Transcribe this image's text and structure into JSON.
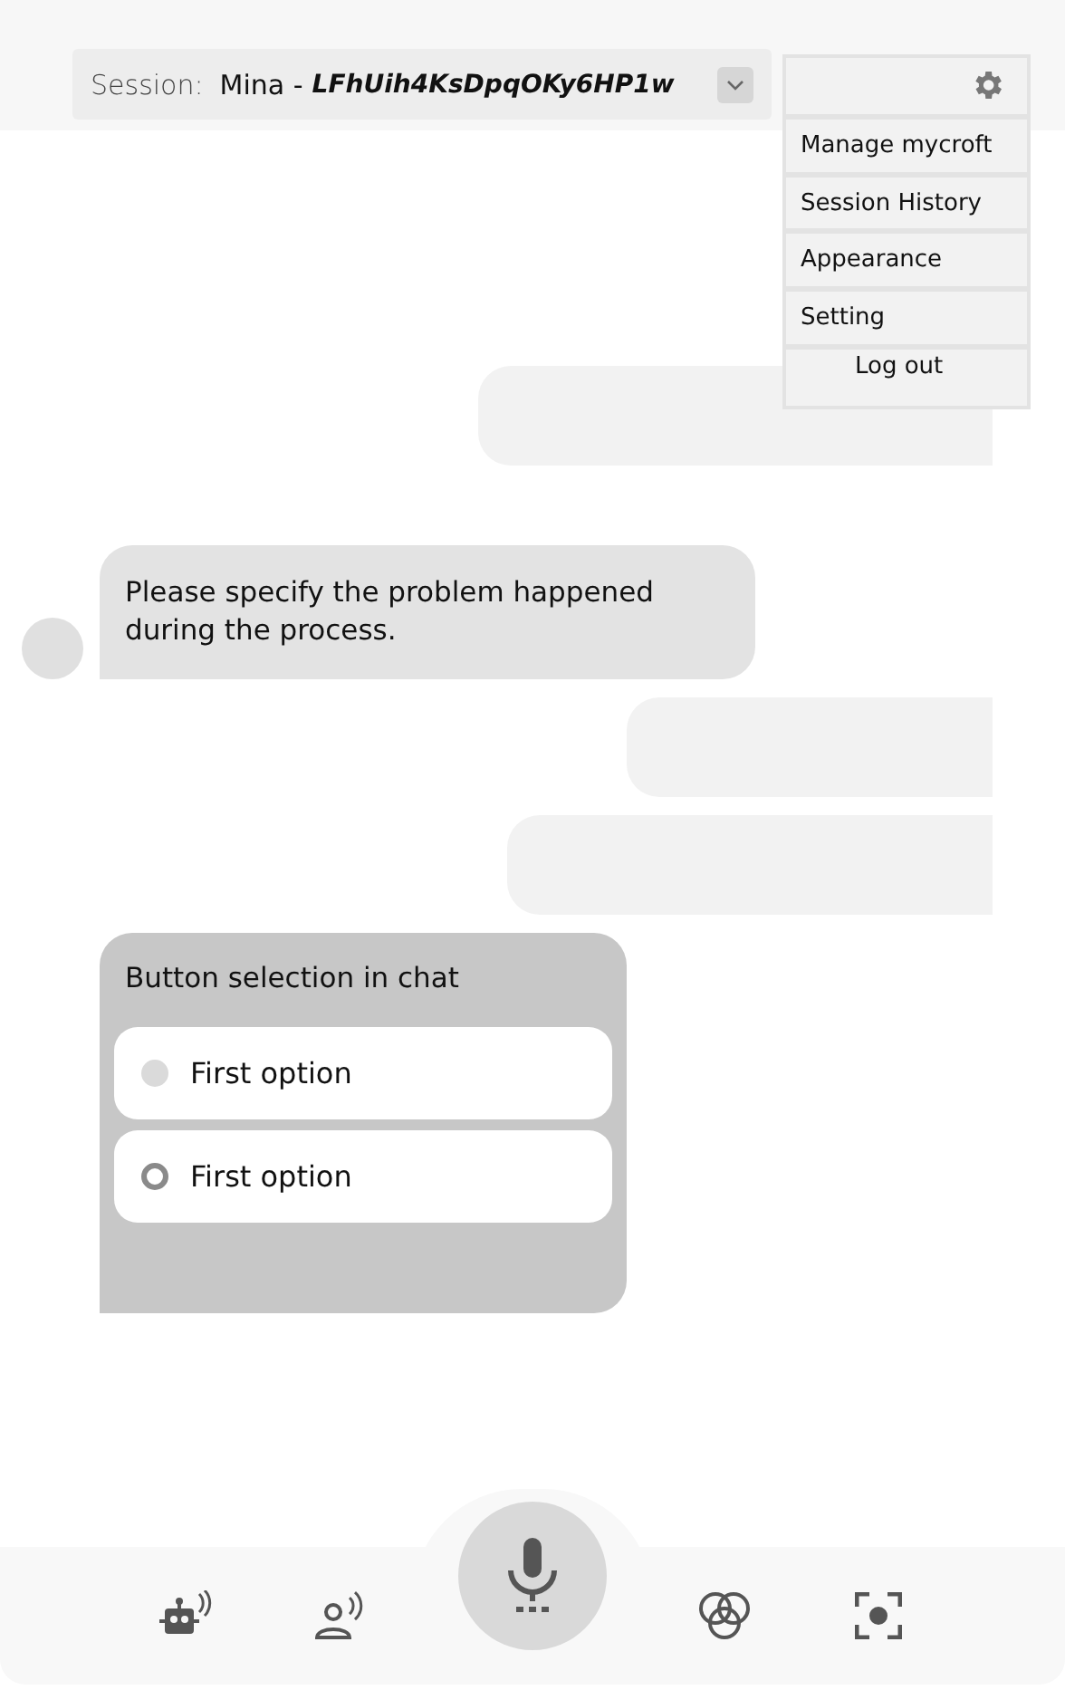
{
  "session": {
    "label": "Session:",
    "user": "Mina -",
    "id": "LFhUih4KsDpqOKy6HP1w"
  },
  "menu": {
    "items": [
      "Manage mycroft",
      "Session History",
      "Appearance",
      "Setting",
      "Log out"
    ]
  },
  "messages": [
    {
      "kind": "user"
    },
    {
      "kind": "bot",
      "text": "Please specify the problem happened during the process."
    },
    {
      "kind": "user"
    },
    {
      "kind": "user"
    },
    {
      "kind": "choice",
      "text": "Button selection in chat",
      "options": [
        {
          "label": "First option",
          "selected": false
        },
        {
          "label": "First option",
          "selected": true
        }
      ]
    }
  ],
  "nav": [
    {
      "kind": "robot"
    },
    {
      "kind": "person"
    },
    {
      "kind": "mic"
    },
    {
      "kind": "circles"
    },
    {
      "kind": "focus"
    }
  ]
}
